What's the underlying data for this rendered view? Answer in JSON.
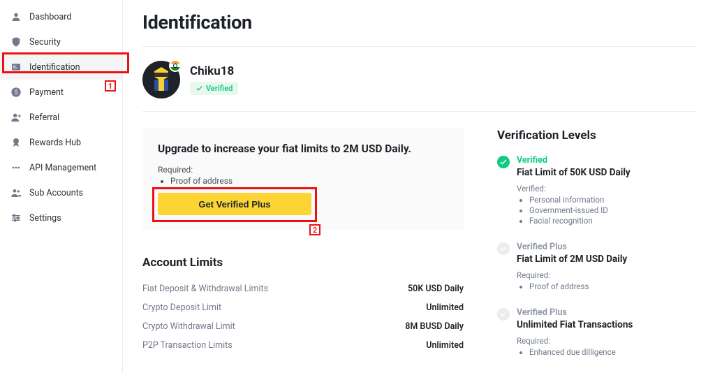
{
  "sidebar": {
    "items": [
      {
        "label": "Dashboard"
      },
      {
        "label": "Security"
      },
      {
        "label": "Identification"
      },
      {
        "label": "Payment"
      },
      {
        "label": "Referral"
      },
      {
        "label": "Rewards Hub"
      },
      {
        "label": "API Management"
      },
      {
        "label": "Sub Accounts"
      },
      {
        "label": "Settings"
      }
    ]
  },
  "annotations": {
    "box1": "1",
    "box2": "2"
  },
  "page": {
    "title": "Identification"
  },
  "profile": {
    "username": "Chiku18",
    "verified_label": "Verified"
  },
  "upgrade": {
    "headline": "Upgrade to increase your fiat limits to 2M USD Daily.",
    "required_label": "Required:",
    "required_items": [
      "Proof of address"
    ],
    "cta": "Get Verified Plus"
  },
  "account_limits": {
    "heading": "Account Limits",
    "rows": [
      {
        "label": "Fiat Deposit & Withdrawal Limits",
        "value": "50K USD Daily"
      },
      {
        "label": "Crypto Deposit Limit",
        "value": "Unlimited"
      },
      {
        "label": "Crypto Withdrawal Limit",
        "value": "8M BUSD Daily"
      },
      {
        "label": "P2P Transaction Limits",
        "value": "Unlimited"
      }
    ]
  },
  "verification_levels": {
    "heading": "Verification Levels",
    "levels": [
      {
        "status": "active",
        "name": "Verified",
        "limit": "Fiat Limit of 50K USD Daily",
        "sub_label": "Verified:",
        "items": [
          "Personal information",
          "Government-issued ID",
          "Facial recognition"
        ]
      },
      {
        "status": "inactive",
        "name": "Verified Plus",
        "limit": "Fiat Limit of 2M USD Daily",
        "sub_label": "Required:",
        "items": [
          "Proof of address"
        ]
      },
      {
        "status": "inactive",
        "name": "Verified Plus",
        "limit": "Unlimited Fiat Transactions",
        "sub_label": "Required:",
        "items": [
          "Enhanced due dilligence"
        ]
      }
    ]
  }
}
